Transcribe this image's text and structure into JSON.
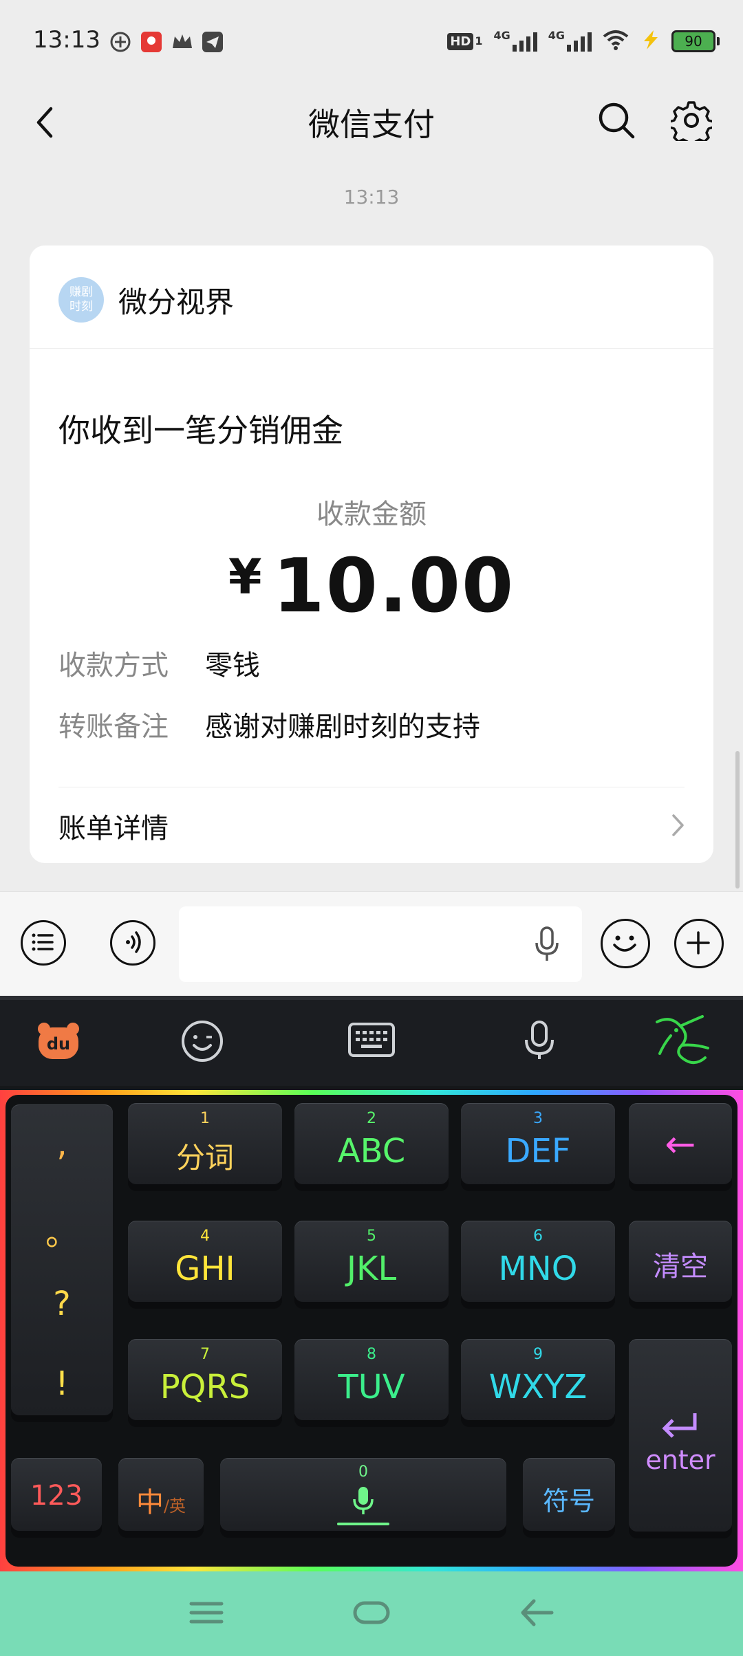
{
  "status_bar": {
    "time": "13:13",
    "hd_label": "HD",
    "hd_sub": "1",
    "sim1": "4G",
    "sim2": "4G",
    "battery": "90"
  },
  "nav": {
    "title": "微信支付"
  },
  "chat": {
    "timestamp": "13:13"
  },
  "card": {
    "avatar_text_line1": "赚剧",
    "avatar_text_line2": "时刻",
    "sender": "微分视界",
    "headline": "你收到一笔分销佣金",
    "amount_label": "收款金额",
    "currency": "¥",
    "amount": "10.00",
    "rows": [
      {
        "label": "收款方式",
        "value": "零钱"
      },
      {
        "label": "转账备注",
        "value": "感谢对赚剧时刻的支持"
      }
    ],
    "details_label": "账单详情"
  },
  "keyboard": {
    "punct": [
      ",",
      "。",
      "?",
      "!"
    ],
    "keys": [
      {
        "num": "1",
        "label": "分词",
        "color": "#ffd35c"
      },
      {
        "num": "2",
        "label": "ABC",
        "color": "#57f56b"
      },
      {
        "num": "3",
        "label": "DEF",
        "color": "#3aa9ff"
      },
      {
        "num": "4",
        "label": "GHI",
        "color": "#ffe53a"
      },
      {
        "num": "5",
        "label": "JKL",
        "color": "#52f06a"
      },
      {
        "num": "6",
        "label": "MNO",
        "color": "#31d9e8"
      },
      {
        "num": "7",
        "label": "PQRS",
        "color": "#c9f03a"
      },
      {
        "num": "8",
        "label": "TUV",
        "color": "#3bee8b"
      },
      {
        "num": "9",
        "label": "WXYZ",
        "color": "#31d9e8"
      }
    ],
    "backspace": "←",
    "clear": "清空",
    "enter": "enter",
    "num_key": "123",
    "lang_main": "中",
    "lang_sub": "/英",
    "space_num": "0",
    "symbols": "符号"
  }
}
